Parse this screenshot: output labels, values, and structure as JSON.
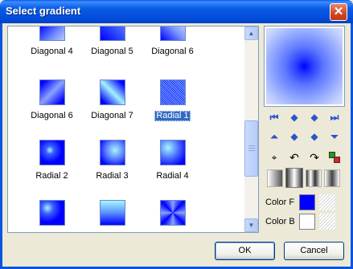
{
  "window": {
    "title": "Select gradient",
    "close_glyph": "✕"
  },
  "gradients": [
    {
      "label": "Diagonal 4",
      "selected": false
    },
    {
      "label": "Diagonal 5",
      "selected": false
    },
    {
      "label": "Diagonal 6",
      "selected": false
    },
    {
      "label": "Diagonal 6",
      "selected": false
    },
    {
      "label": "Diagonal 7",
      "selected": false
    },
    {
      "label": "Radial 1",
      "selected": true
    },
    {
      "label": "Radial 2",
      "selected": false
    },
    {
      "label": "Radial 3",
      "selected": false
    },
    {
      "label": "Radial 4",
      "selected": false
    },
    {
      "label": "",
      "selected": false
    },
    {
      "label": "",
      "selected": false
    },
    {
      "label": "",
      "selected": false
    }
  ],
  "toolbar_icons": [
    "first-icon",
    "prev-icon",
    "next-icon",
    "last-icon",
    "top-icon",
    "up-icon",
    "down-icon",
    "bottom-icon",
    "center-icon",
    "rotate-left-icon",
    "rotate-right-icon",
    "swap-colors-icon"
  ],
  "colors": {
    "color_f_label": "Color F",
    "color_b_label": "Color B",
    "color_f": "#0000ff",
    "color_b": "#ffffff"
  },
  "buttons": {
    "ok": "OK",
    "cancel": "Cancel"
  }
}
